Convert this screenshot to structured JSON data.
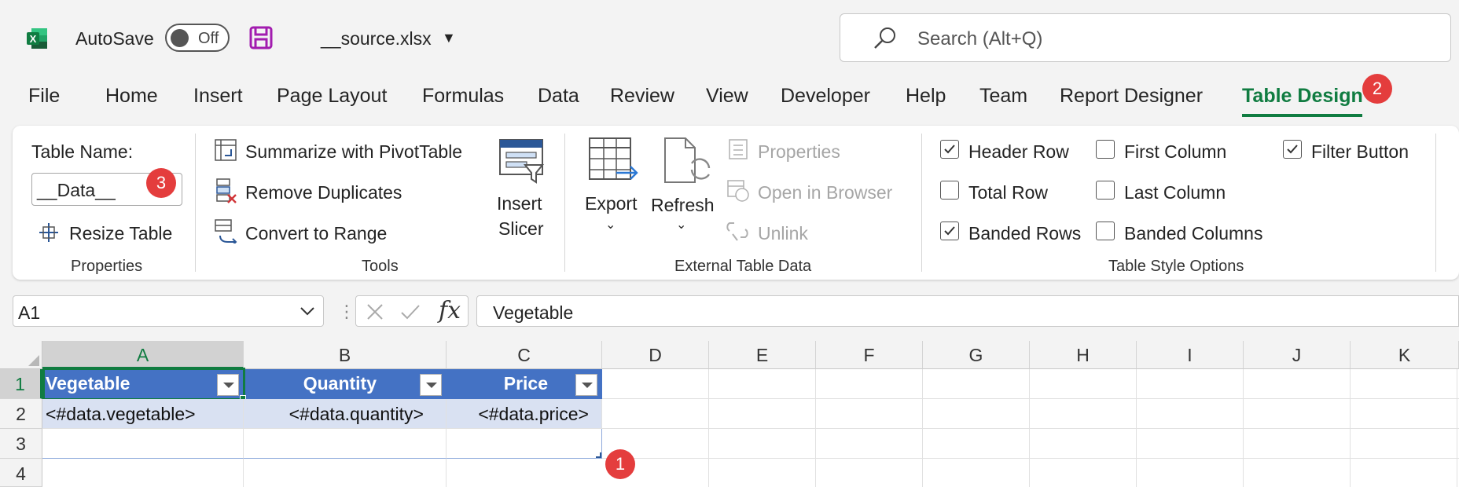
{
  "titlebar": {
    "autosave_label": "AutoSave",
    "autosave_state": "Off",
    "filename": "__source.xlsx",
    "search_placeholder": "Search (Alt+Q)",
    "app_icon": "excel-logo-icon",
    "save_icon": "save-icon"
  },
  "tabs": [
    {
      "label": "File"
    },
    {
      "label": "Home"
    },
    {
      "label": "Insert"
    },
    {
      "label": "Page Layout"
    },
    {
      "label": "Formulas"
    },
    {
      "label": "Data"
    },
    {
      "label": "Review"
    },
    {
      "label": "View"
    },
    {
      "label": "Developer"
    },
    {
      "label": "Help"
    },
    {
      "label": "Team"
    },
    {
      "label": "Report Designer"
    },
    {
      "label": "Table Design",
      "active": true
    }
  ],
  "badges": {
    "one": "1",
    "two": "2",
    "three": "3"
  },
  "ribbon": {
    "properties": {
      "table_name_label": "Table Name:",
      "table_name_value": "__Data__",
      "resize_table": "Resize Table",
      "group_label": "Properties"
    },
    "tools": {
      "summarize": "Summarize with PivotTable",
      "remove_duplicates": "Remove Duplicates",
      "convert_to_range": "Convert to Range",
      "insert_slicer_line1": "Insert",
      "insert_slicer_line2": "Slicer",
      "group_label": "Tools"
    },
    "external": {
      "export": "Export",
      "refresh": "Refresh",
      "properties": "Properties",
      "open_in_browser": "Open in Browser",
      "unlink": "Unlink",
      "group_label": "External Table Data"
    },
    "style_options": {
      "header_row": {
        "label": "Header Row",
        "checked": true
      },
      "total_row": {
        "label": "Total Row",
        "checked": false
      },
      "banded_rows": {
        "label": "Banded Rows",
        "checked": true
      },
      "first_column": {
        "label": "First Column",
        "checked": false
      },
      "last_column": {
        "label": "Last Column",
        "checked": false
      },
      "banded_columns": {
        "label": "Banded Columns",
        "checked": false
      },
      "filter_button": {
        "label": "Filter Button",
        "checked": true
      },
      "group_label": "Table Style Options"
    }
  },
  "formula_bar": {
    "name_box": "A1",
    "fx": "fx",
    "formula": "Vegetable"
  },
  "grid": {
    "columns": [
      "A",
      "B",
      "C",
      "D",
      "E",
      "F",
      "G",
      "H",
      "I",
      "J",
      "K"
    ],
    "rows": [
      "1",
      "2",
      "3",
      "4"
    ],
    "header": [
      "Vegetable",
      "Quantity",
      "Price"
    ],
    "data_row": [
      "<#data.vegetable>",
      "<#data.quantity>",
      "<#data.price>"
    ]
  },
  "colors": {
    "accent": "#107c41",
    "table_header": "#4472c4",
    "table_band": "#d9e1f2",
    "badge": "#e43d3d"
  }
}
